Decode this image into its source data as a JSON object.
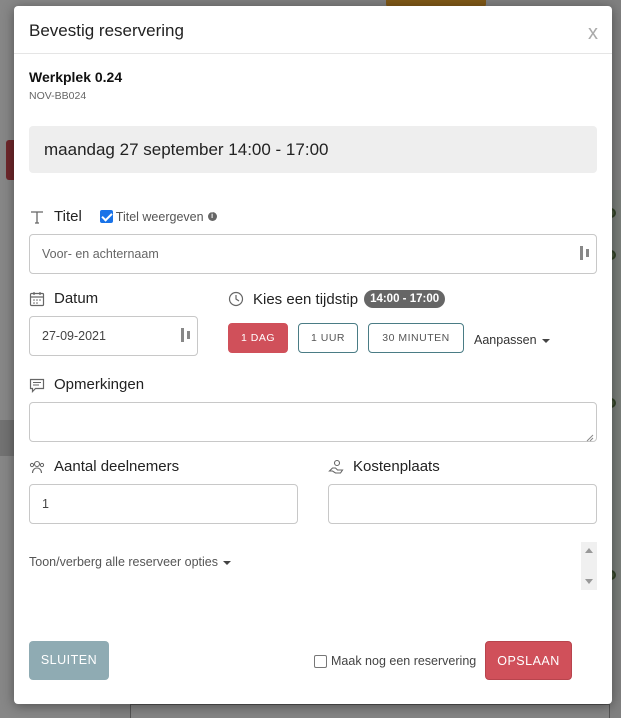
{
  "modal": {
    "title": "Bevestig reservering",
    "close_label": "x",
    "workplace": {
      "name": "Werkplek 0.24",
      "code": "NOV-BB024"
    },
    "date_banner": "maandag 27 september 14:00 - 17:00"
  },
  "title_section": {
    "label": "Titel",
    "show_title_checkbox": {
      "label": "Titel weergeven",
      "checked": true
    },
    "input_placeholder": "Voor- en achternaam"
  },
  "date_section": {
    "label": "Datum",
    "value": "27-09-2021"
  },
  "time_section": {
    "label": "Kies een tijdstip",
    "badge": "14:00 - 17:00",
    "buttons": [
      {
        "label": "1 DAG",
        "active": true
      },
      {
        "label": "1 UUR",
        "active": false
      },
      {
        "label": "30 MINUTEN",
        "active": false
      }
    ],
    "customize_label": "Aanpassen"
  },
  "remarks_section": {
    "label": "Opmerkingen",
    "value": ""
  },
  "participants_section": {
    "label": "Aantal deelnemers",
    "value": "1"
  },
  "cost_center_section": {
    "label": "Kostenplaats",
    "value": ""
  },
  "options_toggle": "Toon/verberg alle reserveer opties",
  "footer": {
    "close_button": "SLUITEN",
    "another_checkbox": {
      "label": "Maak nog een reservering",
      "checked": false
    },
    "save_button": "OPSLAAN"
  },
  "colors": {
    "accent_red": "#d0505a",
    "close_button": "#8fabb3",
    "outline_teal": "#4a7c85",
    "checkbox_blue": "#1a73e8"
  }
}
